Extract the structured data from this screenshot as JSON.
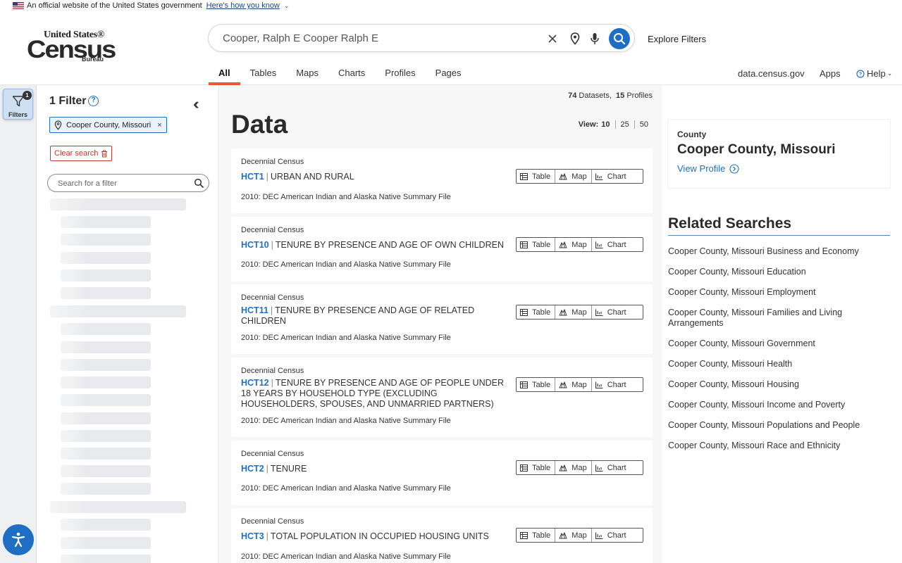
{
  "banner": {
    "text": "An official website of the United States government",
    "link": "Here's how you know"
  },
  "logo": {
    "line1": "United States®",
    "line2": "Census",
    "line3": "Bureau"
  },
  "search": {
    "value": "Cooper, Ralph E Cooper Ralph E",
    "explore": "Explore Filters"
  },
  "tabs": [
    "All",
    "Tables",
    "Maps",
    "Charts",
    "Profiles",
    "Pages"
  ],
  "active_tab": "All",
  "rightnav": {
    "data": "data.census.gov",
    "apps": "Apps",
    "help": "Help"
  },
  "rail": {
    "filters_label": "Filters",
    "badge": "1"
  },
  "filter_panel": {
    "title": "1 Filter",
    "chip": "Cooper County, Missouri",
    "clear": "Clear search",
    "search_placeholder": "Search for a filter"
  },
  "main": {
    "datasets_count": "74",
    "datasets_label": "Datasets,",
    "profiles_count": "15",
    "profiles_label": "Profiles",
    "title": "Data",
    "view_label": "View:",
    "view_options": [
      "10",
      "25",
      "50"
    ],
    "button_labels": {
      "table": "Table",
      "map": "Map",
      "chart": "Chart"
    },
    "results": [
      {
        "source": "Decennial Census",
        "code": "HCT1",
        "title": "URBAN AND RURAL",
        "dataset": "2010: DEC American Indian and Alaska Native Summary File"
      },
      {
        "source": "Decennial Census",
        "code": "HCT10",
        "title": "TENURE BY PRESENCE AND AGE OF OWN CHILDREN",
        "dataset": "2010: DEC American Indian and Alaska Native Summary File"
      },
      {
        "source": "Decennial Census",
        "code": "HCT11",
        "title": "TENURE BY PRESENCE AND AGE OF RELATED CHILDREN",
        "dataset": "2010: DEC American Indian and Alaska Native Summary File"
      },
      {
        "source": "Decennial Census",
        "code": "HCT12",
        "title": "TENURE BY PRESENCE AND AGE OF PEOPLE UNDER 18 YEARS BY HOUSEHOLD TYPE (EXCLUDING HOUSEHOLDERS, SPOUSES, AND UNMARRIED PARTNERS)",
        "dataset": "2010: DEC American Indian and Alaska Native Summary File"
      },
      {
        "source": "Decennial Census",
        "code": "HCT2",
        "title": "TENURE",
        "dataset": "2010: DEC American Indian and Alaska Native Summary File"
      },
      {
        "source": "Decennial Census",
        "code": "HCT3",
        "title": "TOTAL POPULATION IN OCCUPIED HOUSING UNITS",
        "dataset": "2010: DEC American Indian and Alaska Native Summary File"
      }
    ]
  },
  "county": {
    "label": "County",
    "name": "Cooper County, Missouri",
    "view_profile": "View Profile"
  },
  "related": {
    "title": "Related Searches",
    "items": [
      "Cooper County, Missouri Business and Economy",
      "Cooper County, Missouri Education",
      "Cooper County, Missouri Employment",
      "Cooper County, Missouri Families and Living Arrangements",
      "Cooper County, Missouri Government",
      "Cooper County, Missouri Health",
      "Cooper County, Missouri Housing",
      "Cooper County, Missouri Income and Poverty",
      "Cooper County, Missouri Populations and People",
      "Cooper County, Missouri Race and Ethnicity"
    ]
  },
  "colors": {
    "accent": "#1e6fc3",
    "tab_underline": "#e85b2b",
    "clear": "#c0392b"
  },
  "icons": [
    "flag-icon",
    "chevron-down-icon",
    "clear-icon",
    "location-icon",
    "microphone-icon",
    "search-icon",
    "help-circle-icon",
    "filter-icon",
    "accessibility-icon",
    "double-chevron-left-icon",
    "trash-icon",
    "table-icon",
    "map-icon",
    "chart-icon",
    "arrow-circle-icon"
  ]
}
